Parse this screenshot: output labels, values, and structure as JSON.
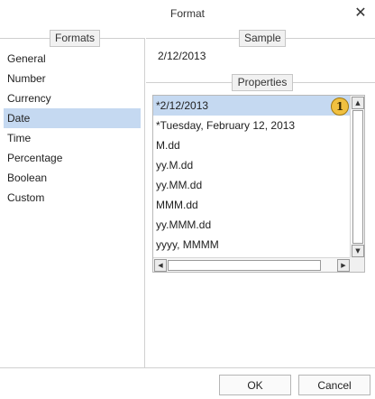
{
  "dialog": {
    "title": "Format",
    "close_glyph": "✕"
  },
  "sections": {
    "formats": "Formats",
    "sample": "Sample",
    "properties": "Properties"
  },
  "formats": {
    "items": [
      "General",
      "Number",
      "Currency",
      "Date",
      "Time",
      "Percentage",
      "Boolean",
      "Custom"
    ],
    "selected": "Date"
  },
  "sample": {
    "value": "2/12/2013"
  },
  "properties": {
    "items": [
      "*2/12/2013",
      "*Tuesday, February 12, 2013",
      "M.dd",
      "yy.M.dd",
      "yy.MM.dd",
      "MMM.dd",
      "yy.MMM.dd",
      "yyyy, MMMM"
    ],
    "selected": "*2/12/2013"
  },
  "badge": {
    "text": "1",
    "color": "#f0c040"
  },
  "scrollbar": {
    "up": "▲",
    "down": "▼",
    "left": "◀",
    "right": "▶"
  },
  "buttons": {
    "ok": "OK",
    "cancel": "Cancel"
  },
  "colors": {
    "selection": "#c5d9f1",
    "border": "#d0d0d0"
  }
}
